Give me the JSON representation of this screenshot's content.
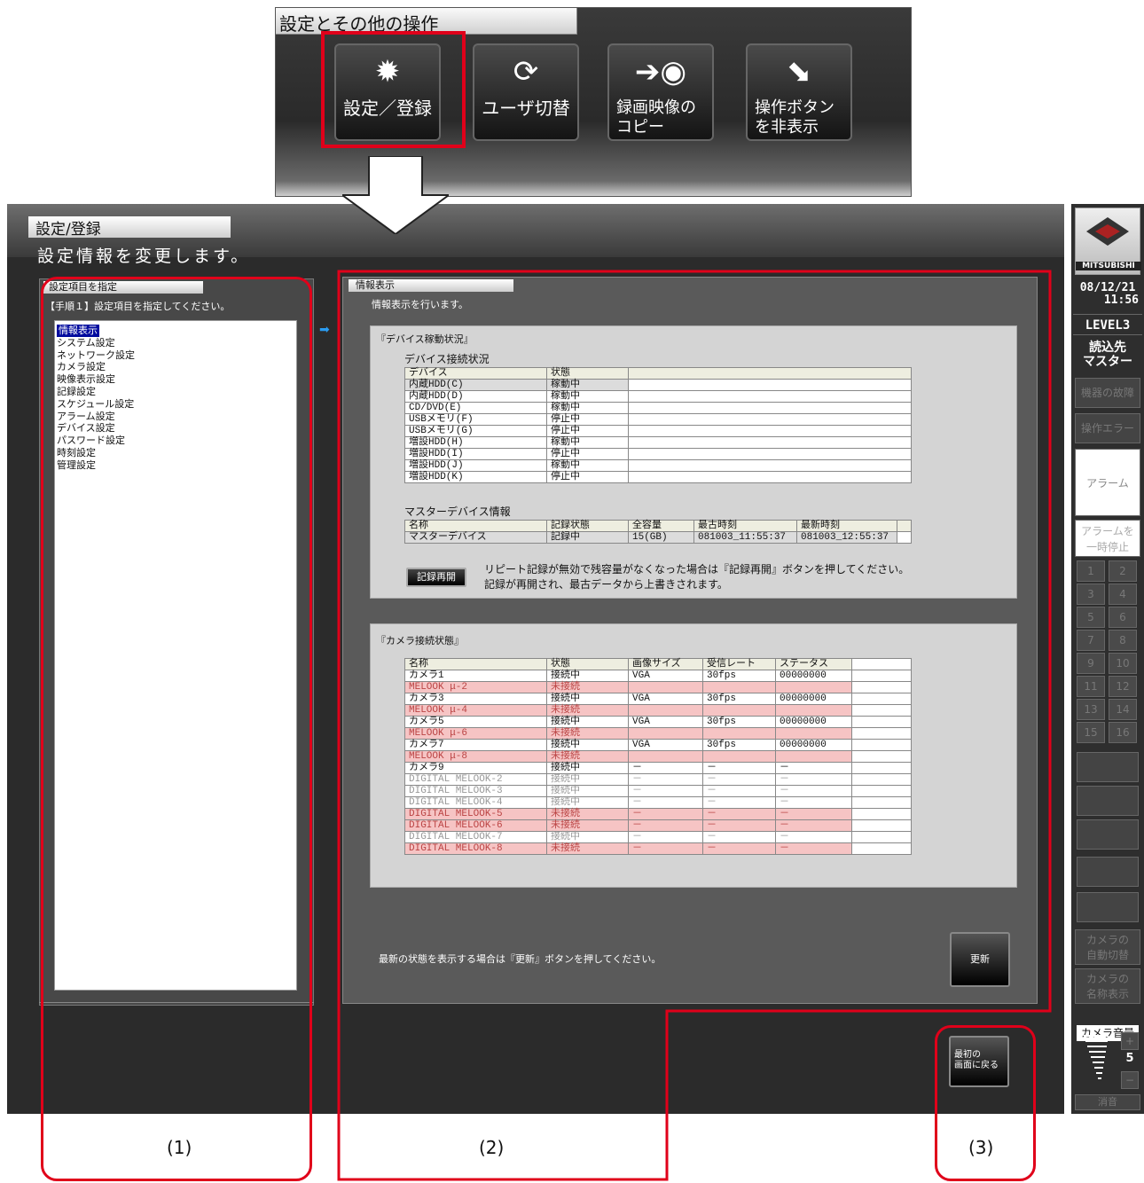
{
  "top": {
    "title": "設定とその他の操作",
    "buttons": [
      {
        "label": "設定／登録",
        "icon": "gear-icon"
      },
      {
        "label": "ユーザ切替",
        "icon": "refresh-icon"
      },
      {
        "label": "録画映像の\nコピー",
        "icon": "disc-copy-icon"
      },
      {
        "label": "操作ボタン\nを非表示",
        "icon": "hide-arrow-icon"
      }
    ]
  },
  "header": {
    "title": "設定/登録",
    "subtitle": "設定情報を変更します。"
  },
  "left": {
    "tab": "設定項目を指定",
    "instruction": "【手順１】設定項目を指定してください。",
    "items": [
      "情報表示",
      "システム設定",
      "ネットワーク設定",
      "カメラ設定",
      "映像表示設定",
      "記録設定",
      "スケジュール設定",
      "アラーム設定",
      "デバイス設定",
      "パスワード設定",
      "時刻設定",
      "管理設定"
    ]
  },
  "right": {
    "tab": "情報表示",
    "instruction": "情報表示を行います。",
    "device_section": "『デバイス稼動状況』",
    "device_conn": "デバイス接続状況",
    "device_headers": [
      "デバイス",
      "状態",
      ""
    ],
    "devices": [
      [
        "内蔵HDD(C)",
        "稼動中"
      ],
      [
        "内蔵HDD(D)",
        "稼動中"
      ],
      [
        "CD/DVD(E)",
        "稼動中"
      ],
      [
        "USBメモリ(F)",
        "停止中"
      ],
      [
        "USBメモリ(G)",
        "停止中"
      ],
      [
        "増設HDD(H)",
        "稼動中"
      ],
      [
        "増設HDD(I)",
        "停止中"
      ],
      [
        "増設HDD(J)",
        "稼動中"
      ],
      [
        "増設HDD(K)",
        "停止中"
      ]
    ],
    "master_title": "マスターデバイス情報",
    "master_headers": [
      "名称",
      "記録状態",
      "全容量",
      "最古時刻",
      "最新時刻"
    ],
    "master_row": [
      "マスターデバイス",
      "記録中",
      "15(GB)",
      "081003_11:55:37",
      "081003_12:55:37"
    ],
    "resume_label": "記録再開",
    "resume_note1": "リピート記録が無効で残容量がなくなった場合は『記録再開』ボタンを押してください。",
    "resume_note2": "記録が再開され、最古データから上書きされます。",
    "camera_section": "『カメラ接続状態』",
    "camera_headers": [
      "名称",
      "状態",
      "画像サイズ",
      "受信レート",
      "ステータス"
    ],
    "cameras": [
      {
        "c": [
          "カメラ1",
          "接続中",
          "VGA",
          "30fps",
          "00000000"
        ],
        "s": "wh"
      },
      {
        "c": [
          "MELOOK μ-2",
          "未接続",
          "",
          "",
          ""
        ],
        "s": "pk"
      },
      {
        "c": [
          "カメラ3",
          "接続中",
          "VGA",
          "30fps",
          "00000000"
        ],
        "s": "wh"
      },
      {
        "c": [
          "MELOOK μ-4",
          "未接続",
          "",
          "",
          ""
        ],
        "s": "pk"
      },
      {
        "c": [
          "カメラ5",
          "接続中",
          "VGA",
          "30fps",
          "00000000"
        ],
        "s": "wh"
      },
      {
        "c": [
          "MELOOK μ-6",
          "未接続",
          "",
          "",
          ""
        ],
        "s": "pk"
      },
      {
        "c": [
          "カメラ7",
          "接続中",
          "VGA",
          "30fps",
          "00000000"
        ],
        "s": "wh"
      },
      {
        "c": [
          "MELOOK μ-8",
          "未接続",
          "",
          "",
          ""
        ],
        "s": "pk"
      },
      {
        "c": [
          "カメラ9",
          "接続中",
          "－",
          "－",
          "－"
        ],
        "s": "wh"
      },
      {
        "c": [
          "DIGITAL MELOOK-2",
          "接続中",
          "－",
          "－",
          "－"
        ],
        "s": "gy"
      },
      {
        "c": [
          "DIGITAL MELOOK-3",
          "接続中",
          "－",
          "－",
          "－"
        ],
        "s": "gy"
      },
      {
        "c": [
          "DIGITAL MELOOK-4",
          "接続中",
          "－",
          "－",
          "－"
        ],
        "s": "gy"
      },
      {
        "c": [
          "DIGITAL MELOOK-5",
          "未接続",
          "－",
          "－",
          "－"
        ],
        "s": "pk"
      },
      {
        "c": [
          "DIGITAL MELOOK-6",
          "未接続",
          "－",
          "－",
          "－"
        ],
        "s": "pk"
      },
      {
        "c": [
          "DIGITAL MELOOK-7",
          "接続中",
          "－",
          "－",
          "－"
        ],
        "s": "gy"
      },
      {
        "c": [
          "DIGITAL MELOOK-8",
          "未接続",
          "－",
          "－",
          "－"
        ],
        "s": "pk"
      }
    ],
    "update_note": "最新の状態を表示する場合は『更新』ボタンを押してください。",
    "update_label": "更新",
    "back_label": "最初の\n画面に戻る"
  },
  "sidebar": {
    "brand": "MITSUBISHI",
    "date": "08/12/21",
    "time": "11:56",
    "level": "LEVEL3",
    "read": "読込先\nマスター",
    "fault": "機器の故障",
    "oper_err": "操作エラー",
    "alarm": "アラーム",
    "alarm_pause": "アラームを\n一時停止",
    "nums": [
      "1",
      "2",
      "3",
      "4",
      "5",
      "6",
      "7",
      "8",
      "9",
      "10",
      "11",
      "12",
      "13",
      "14",
      "15",
      "16"
    ],
    "auto_switch": "カメラの\n自動切替",
    "name_disp": "カメラの\n名称表示",
    "volume": "カメラ音量",
    "vol_value": "5",
    "mute": "消音"
  },
  "annotations": [
    "(1)",
    "(2)",
    "(3)"
  ]
}
